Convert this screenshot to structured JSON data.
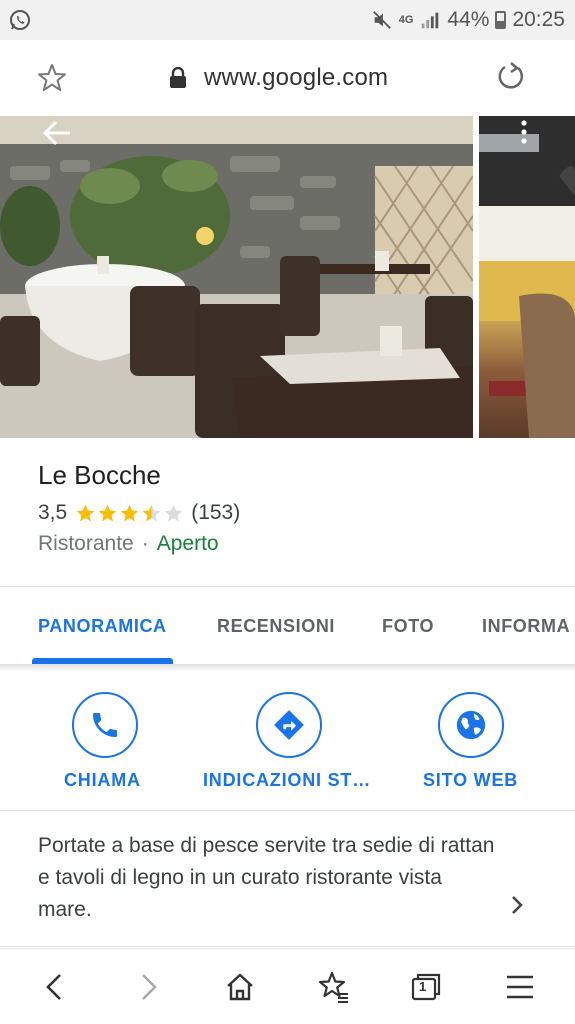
{
  "status_bar": {
    "network": "4G",
    "battery": "44%",
    "time": "20:25"
  },
  "browser": {
    "url": "www.google.com"
  },
  "place": {
    "name": "Le Bocche",
    "rating": "3,5",
    "rating_value": 3.5,
    "reviews_count": "(153)",
    "category": "Ristorante",
    "separator": "·",
    "status": "Aperto"
  },
  "tabs": [
    {
      "label": "PANORAMICA",
      "active": true
    },
    {
      "label": "RECENSIONI",
      "active": false
    },
    {
      "label": "FOTO",
      "active": false
    },
    {
      "label": "INFORMA",
      "active": false
    }
  ],
  "actions": [
    {
      "label": "CHIAMA",
      "icon": "phone-icon"
    },
    {
      "label": "INDICAZIONI ST…",
      "icon": "directions-icon"
    },
    {
      "label": "SITO WEB",
      "icon": "globe-icon"
    }
  ],
  "description": "Portate a base di pesce servite tra sedie di rattan e tavoli di legno in un curato ristorante vista mare.",
  "bottom_nav": {
    "tab_count": "1"
  },
  "colors": {
    "accent": "#1a73e8",
    "star": "#fbbc04",
    "open": "#188038"
  }
}
